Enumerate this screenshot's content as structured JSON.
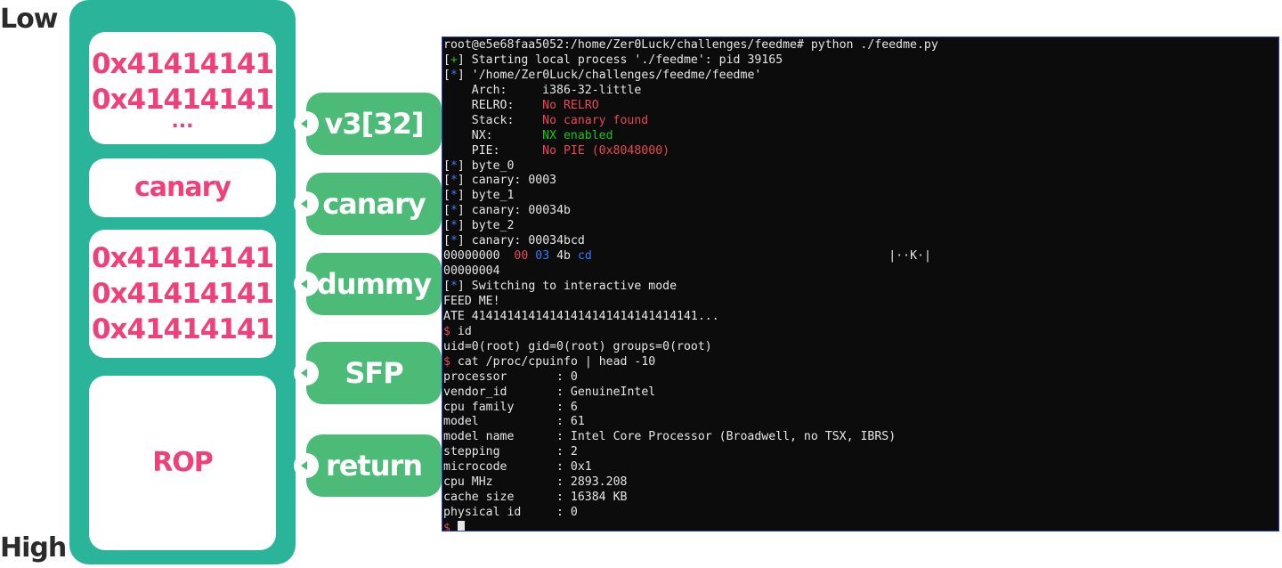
{
  "labels": {
    "low": "Low",
    "high": "High"
  },
  "stack": {
    "buffer": [
      "0x41414141",
      "0x41414141",
      "..."
    ],
    "canary": "canary",
    "dummy": [
      "0x41414141",
      "0x41414141",
      "0x41414141"
    ],
    "rop": "ROP"
  },
  "tags": {
    "v3": "v3[32]",
    "canary": "canary",
    "dummy": "dummy",
    "sfp": "SFP",
    "return": "return"
  },
  "colors": {
    "stack_bg": "#2ab49a",
    "cell_text": "#f0407a",
    "tag_bg": "#4cbb78",
    "terminal_bg": "#0c0c0c"
  },
  "terminal": {
    "cmd1": "root@e5e68faa5052:/home/Zer0Luck/challenges/feedme# python ./feedme.py",
    "mark_plus": "+",
    "mark_star": "*",
    "l1": "Starting local process './feedme': pid 39165",
    "l2": "'/home/Zer0Luck/challenges/feedme/feedme'",
    "arch_k": "    Arch:     ",
    "arch_v": "i386-32-little",
    "relro_k": "    RELRO:    ",
    "relro_v": "No RELRO",
    "stack_k": "    Stack:    ",
    "stack_v": "No canary found",
    "nx_k": "    NX:       ",
    "nx_v": "NX enabled",
    "pie_k": "    PIE:      ",
    "pie_v": "No PIE (0x8048000)",
    "byte0": "byte_0",
    "can1": "canary: 0003",
    "byte1": "byte_1",
    "can2": "canary: 00034b",
    "byte2": "byte_2",
    "can3": "canary: 00034bcd",
    "hex_off": "00000000  ",
    "hex_b0": "00",
    "hex_b1": "03",
    "hex_b2": "4b",
    "hex_b3": "cd",
    "hex_ascii": "|··K·|",
    "hex_end": "00000004",
    "switching": "Switching to interactive mode",
    "feed": "FEED ME!",
    "ate": "ATE 41414141414141414141414141414141...",
    "prompt": "$",
    "cmd_id": "id",
    "uid": "uid=0(root) gid=0(root) groups=0(root)",
    "cmd_cpu": "cat /proc/cpuinfo | head -10",
    "cpu": [
      "processor\t: 0",
      "vendor_id\t: GenuineIntel",
      "cpu family\t: 6",
      "model\t\t: 61",
      "model name\t: Intel Core Processor (Broadwell, no TSX, IBRS)",
      "stepping\t: 2",
      "microcode\t: 0x1",
      "cpu MHz\t\t: 2893.208",
      "cache size\t: 16384 KB",
      "physical id\t: 0"
    ]
  }
}
